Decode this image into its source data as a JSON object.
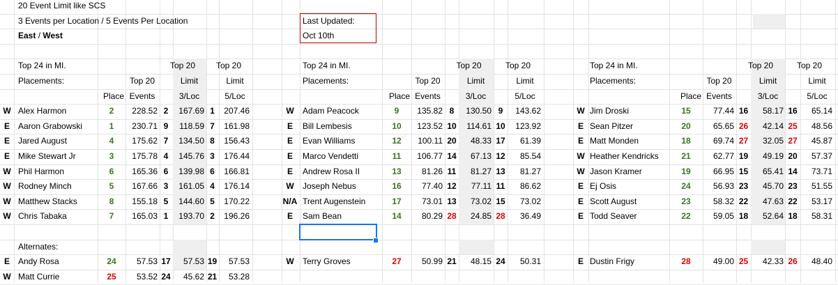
{
  "header": {
    "line1": "20 Event Limit like SCS",
    "line2": "3 Events per Location / 5 Events Per Location",
    "line3_a": "East",
    "line3_sep": " / ",
    "line3_b": "West",
    "updated_label": "Last Updated:",
    "updated_value": "Oct 10th"
  },
  "titles": {
    "top24": "Top 24 in MI.",
    "placements": "Placements:",
    "place": "Place",
    "top20a": "Top 20",
    "events": "Events",
    "top20b": "Top 20",
    "limit": "Limit",
    "loc3": "3/Loc",
    "top20c": "Top 20",
    "limit2": "Limit",
    "loc5": "5/Loc",
    "alternates": "Alternates:"
  },
  "groups": [
    {
      "rows": [
        {
          "region": "W",
          "name": "Alex Harmon",
          "place": "2",
          "place_color": "green",
          "events": "228.52",
          "r3": "2",
          "r3_color": "black",
          "l3": "167.69",
          "r5": "1",
          "r5_color": "black",
          "l5": "207.46"
        },
        {
          "region": "E",
          "name": "Aaron Grabowski",
          "place": "1",
          "place_color": "green",
          "events": "230.71",
          "r3": "9",
          "r3_color": "black",
          "l3": "118.59",
          "r5": "7",
          "r5_color": "black",
          "l5": "161.98"
        },
        {
          "region": "E",
          "name": "Jared August",
          "place": "4",
          "place_color": "green",
          "events": "175.62",
          "r3": "7",
          "r3_color": "black",
          "l3": "134.50",
          "r5": "8",
          "r5_color": "black",
          "l5": "156.43"
        },
        {
          "region": "E",
          "name": "Mike Stewart Jr",
          "place": "3",
          "place_color": "green",
          "events": "175.78",
          "r3": "4",
          "r3_color": "black",
          "l3": "145.76",
          "r5": "3",
          "r5_color": "black",
          "l5": "176.44"
        },
        {
          "region": "W",
          "name": "Phil Harmon",
          "place": "6",
          "place_color": "green",
          "events": "165.36",
          "r3": "6",
          "r3_color": "black",
          "l3": "139.98",
          "r5": "6",
          "r5_color": "black",
          "l5": "166.81"
        },
        {
          "region": "W",
          "name": "Rodney Minch",
          "place": "5",
          "place_color": "green",
          "events": "167.66",
          "r3": "3",
          "r3_color": "black",
          "l3": "161.05",
          "r5": "4",
          "r5_color": "black",
          "l5": "176.14"
        },
        {
          "region": "W",
          "name": "Matthew Stacks",
          "place": "8",
          "place_color": "green",
          "events": "155.18",
          "r3": "5",
          "r3_color": "black",
          "l3": "144.60",
          "r5": "5",
          "r5_color": "black",
          "l5": "170.22"
        },
        {
          "region": "W",
          "name": "Chris Tabaka",
          "place": "7",
          "place_color": "green",
          "events": "165.03",
          "r3": "1",
          "r3_color": "black",
          "l3": "193.70",
          "r5": "2",
          "r5_color": "black",
          "l5": "196.26"
        }
      ],
      "alternates": [
        {
          "region": "E",
          "name": "Andy Rosa",
          "place": "24",
          "place_color": "green",
          "events": "57.53",
          "r3": "17",
          "r3_color": "black",
          "l3": "57.53",
          "r5": "19",
          "r5_color": "black",
          "l5": "57.53"
        },
        {
          "region": "W",
          "name": "Matt Currie",
          "place": "25",
          "place_color": "red",
          "events": "53.52",
          "r3": "24",
          "r3_color": "black",
          "l3": "45.62",
          "r5": "21",
          "r5_color": "black",
          "l5": "53.28"
        }
      ]
    },
    {
      "rows": [
        {
          "region": "W",
          "name": "Adam Peacock",
          "place": "9",
          "place_color": "green",
          "events": "135.82",
          "r3": "8",
          "r3_color": "black",
          "l3": "130.50",
          "r5": "9",
          "r5_color": "black",
          "l5": "143.62"
        },
        {
          "region": "E",
          "name": "Bill Lembesis",
          "place": "10",
          "place_color": "green",
          "events": "123.52",
          "r3": "10",
          "r3_color": "black",
          "l3": "114.61",
          "r5": "10",
          "r5_color": "black",
          "l5": "123.92"
        },
        {
          "region": "E",
          "name": "Evan Williams",
          "place": "12",
          "place_color": "green",
          "events": "100.11",
          "r3": "20",
          "r3_color": "black",
          "l3": "48.33",
          "r5": "17",
          "r5_color": "black",
          "l5": "61.39"
        },
        {
          "region": "E",
          "name": "Marco Vendetti",
          "place": "11",
          "place_color": "green",
          "events": "106.77",
          "r3": "14",
          "r3_color": "black",
          "l3": "67.13",
          "r5": "12",
          "r5_color": "black",
          "l5": "85.54"
        },
        {
          "region": "E",
          "name": "Andrew Rosa II",
          "place": "13",
          "place_color": "green",
          "events": "81.26",
          "r3": "11",
          "r3_color": "black",
          "l3": "81.27",
          "r5": "13",
          "r5_color": "black",
          "l5": "81.27"
        },
        {
          "region": "W",
          "name": "Joseph Nebus",
          "place": "16",
          "place_color": "green",
          "events": "77.40",
          "r3": "12",
          "r3_color": "black",
          "l3": "77.11",
          "r5": "11",
          "r5_color": "black",
          "l5": "86.62"
        },
        {
          "region": "N/A",
          "name": "Trent Augenstein",
          "place": "17",
          "place_color": "green",
          "events": "73.01",
          "r3": "13",
          "r3_color": "black",
          "l3": "73.02",
          "r5": "15",
          "r5_color": "black",
          "l5": "73.02"
        },
        {
          "region": "E",
          "name": "Sam Bean",
          "place": "14",
          "place_color": "green",
          "events": "80.29",
          "r3": "28",
          "r3_color": "red",
          "l3": "24.85",
          "r5": "28",
          "r5_color": "red",
          "l5": "36.49"
        }
      ],
      "alternates": [
        {
          "region": "W",
          "name": "Terry Groves",
          "place": "27",
          "place_color": "red",
          "events": "50.99",
          "r3": "21",
          "r3_color": "black",
          "l3": "48.15",
          "r5": "24",
          "r5_color": "black",
          "l5": "50.31"
        }
      ]
    },
    {
      "rows": [
        {
          "region": "W",
          "name": "Jim Droski",
          "place": "15",
          "place_color": "green",
          "events": "77.44",
          "r3": "16",
          "r3_color": "black",
          "l3": "58.17",
          "r5": "16",
          "r5_color": "black",
          "l5": "65.14"
        },
        {
          "region": "E",
          "name": "Sean Pitzer",
          "place": "20",
          "place_color": "green",
          "events": "65.65",
          "r3": "26",
          "r3_color": "red",
          "l3": "42.14",
          "r5": "25",
          "r5_color": "red",
          "l5": "48.56"
        },
        {
          "region": "E",
          "name": "Matt Monden",
          "place": "18",
          "place_color": "green",
          "events": "69.74",
          "r3": "27",
          "r3_color": "red",
          "l3": "32.05",
          "r5": "27",
          "r5_color": "red",
          "l5": "45.87"
        },
        {
          "region": "W",
          "name": "Heather Kendricks",
          "place": "21",
          "place_color": "green",
          "events": "62.77",
          "r3": "19",
          "r3_color": "black",
          "l3": "49.19",
          "r5": "20",
          "r5_color": "black",
          "l5": "57.37"
        },
        {
          "region": "W",
          "name": "Jason Kramer",
          "place": "19",
          "place_color": "green",
          "events": "66.95",
          "r3": "15",
          "r3_color": "black",
          "l3": "65.41",
          "r5": "14",
          "r5_color": "black",
          "l5": "73.71"
        },
        {
          "region": "E",
          "name": "Ej Osis",
          "place": "24",
          "place_color": "green",
          "events": "56.93",
          "r3": "23",
          "r3_color": "black",
          "l3": "45.70",
          "r5": "23",
          "r5_color": "black",
          "l5": "51.55"
        },
        {
          "region": "E",
          "name": "Scott August",
          "place": "23",
          "place_color": "green",
          "events": "58.32",
          "r3": "22",
          "r3_color": "black",
          "l3": "47.63",
          "r5": "22",
          "r5_color": "black",
          "l5": "53.17"
        },
        {
          "region": "E",
          "name": "Todd Seaver",
          "place": "22",
          "place_color": "green",
          "events": "59.05",
          "r3": "18",
          "r3_color": "black",
          "l3": "52.64",
          "r5": "18",
          "r5_color": "black",
          "l5": "58.31"
        }
      ],
      "alternates": [
        {
          "region": "E",
          "name": "Dustin Frigy",
          "place": "28",
          "place_color": "red",
          "events": "49.00",
          "r3": "25",
          "r3_color": "red",
          "l3": "42.33",
          "r5": "26",
          "r5_color": "red",
          "l5": "48.40"
        }
      ]
    }
  ]
}
